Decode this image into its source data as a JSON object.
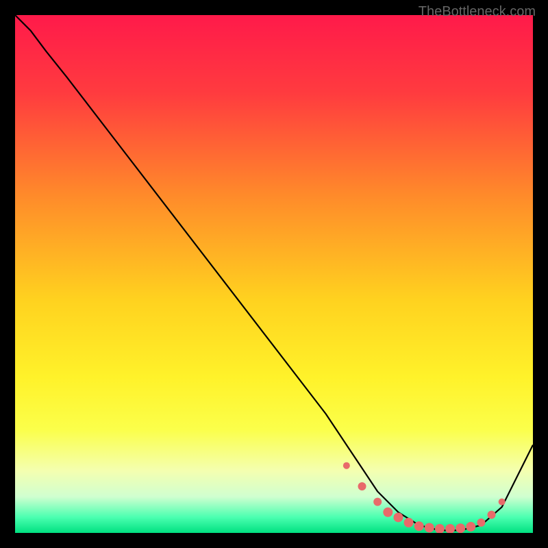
{
  "watermark": "TheBottleneck.com",
  "chart_data": {
    "type": "line",
    "title": "",
    "xlabel": "",
    "ylabel": "",
    "xlim": [
      0,
      100
    ],
    "ylim": [
      0,
      100
    ],
    "background_gradient": {
      "stops": [
        {
          "offset": 0,
          "color": "#ff1a4a"
        },
        {
          "offset": 15,
          "color": "#ff3b3f"
        },
        {
          "offset": 35,
          "color": "#ff8b2a"
        },
        {
          "offset": 55,
          "color": "#ffd21f"
        },
        {
          "offset": 70,
          "color": "#fff22a"
        },
        {
          "offset": 80,
          "color": "#fbff4a"
        },
        {
          "offset": 88,
          "color": "#f4ffb0"
        },
        {
          "offset": 93,
          "color": "#d0ffd0"
        },
        {
          "offset": 97,
          "color": "#4affb0"
        },
        {
          "offset": 100,
          "color": "#00e080"
        }
      ]
    },
    "series": [
      {
        "name": "bottleneck-curve",
        "color": "#000000",
        "x": [
          0,
          3,
          6,
          10,
          20,
          30,
          40,
          50,
          60,
          66,
          70,
          74,
          78,
          82,
          86,
          90,
          94,
          100
        ],
        "y": [
          100,
          97,
          93,
          88,
          75,
          62,
          49,
          36,
          23,
          14,
          8,
          4,
          1.5,
          0.5,
          0.5,
          1.5,
          5,
          17
        ]
      }
    ],
    "markers": {
      "name": "optimal-range-dots",
      "color": "#e86a6a",
      "x": [
        64,
        67,
        70,
        72,
        74,
        76,
        78,
        80,
        82,
        84,
        86,
        88,
        90,
        92,
        94
      ],
      "y": [
        13,
        9,
        6,
        4,
        3,
        2,
        1.3,
        1,
        0.8,
        0.8,
        0.9,
        1.2,
        2,
        3.5,
        6
      ],
      "size": [
        5,
        6,
        6,
        7,
        7,
        7,
        7,
        7,
        7,
        7,
        7,
        7,
        6,
        6,
        5
      ]
    }
  }
}
